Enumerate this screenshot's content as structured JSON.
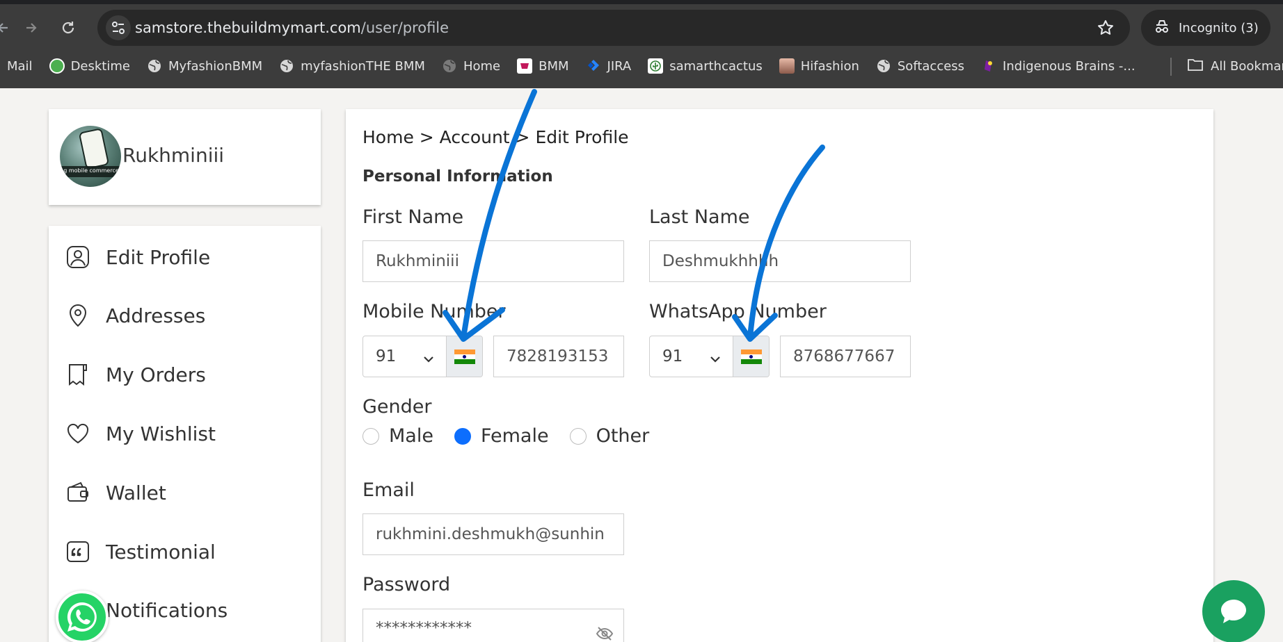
{
  "browser": {
    "url_host": "samstore.thebuildmymart.com",
    "url_path": "/user/profile",
    "incognito_label": "Incognito (3)",
    "bookmarks": [
      {
        "label": "Mail",
        "icon": "mail-icon"
      },
      {
        "label": "Desktime",
        "icon": "desktime-icon"
      },
      {
        "label": "MyfashionBMM",
        "icon": "globe-icon"
      },
      {
        "label": "myfashionTHE BMM",
        "icon": "globe-icon"
      },
      {
        "label": "Home",
        "icon": "globe-icon"
      },
      {
        "label": "BMM",
        "icon": "bmm-icon"
      },
      {
        "label": "JIRA",
        "icon": "jira-icon"
      },
      {
        "label": "samarthcactus",
        "icon": "cactus-icon"
      },
      {
        "label": "Hifashion",
        "icon": "hifashion-icon"
      },
      {
        "label": "Softaccess",
        "icon": "globe-icon"
      },
      {
        "label": "Indigenous Brains -...",
        "icon": "indigenous-icon"
      }
    ],
    "all_bookmarks_label": "All Bookmarks"
  },
  "profile": {
    "name": "Rukhminiii",
    "avatar_text": "g mobile commerce"
  },
  "menu": {
    "items": [
      {
        "label": "Edit Profile",
        "icon": "user-icon"
      },
      {
        "label": "Addresses",
        "icon": "location-pin-icon"
      },
      {
        "label": "My Orders",
        "icon": "receipt-icon"
      },
      {
        "label": "My Wishlist",
        "icon": "heart-icon"
      },
      {
        "label": "Wallet",
        "icon": "wallet-icon"
      },
      {
        "label": "Testimonial",
        "icon": "quote-icon"
      },
      {
        "label": "Notifications",
        "icon": "bell-icon"
      }
    ]
  },
  "main": {
    "breadcrumb": "Home > Account > Edit Profile",
    "section_title": "Personal Information",
    "first_name_label": "First Name",
    "first_name_value": "Rukhminiii",
    "last_name_label": "Last Name",
    "last_name_value": "Deshmukhhhh",
    "mobile_label": "Mobile Number",
    "mobile_code": "91",
    "mobile_value": "7828193153",
    "whatsapp_label": "WhatsApp Number",
    "whatsapp_code": "91",
    "whatsapp_value": "8768677667",
    "gender_label": "Gender",
    "gender_options": [
      "Male",
      "Female",
      "Other"
    ],
    "gender_selected": "Female",
    "email_label": "Email",
    "email_value": "rukhmini.deshmukh@sunhin",
    "password_label": "Password",
    "password_value": "************"
  },
  "colors": {
    "accent": "#0d6efd",
    "annotation_arrow": "#0a74d6",
    "whatsapp": "#25d366",
    "chat": "#1aa160",
    "flag_saffron": "#ff9933",
    "flag_green": "#138808"
  }
}
